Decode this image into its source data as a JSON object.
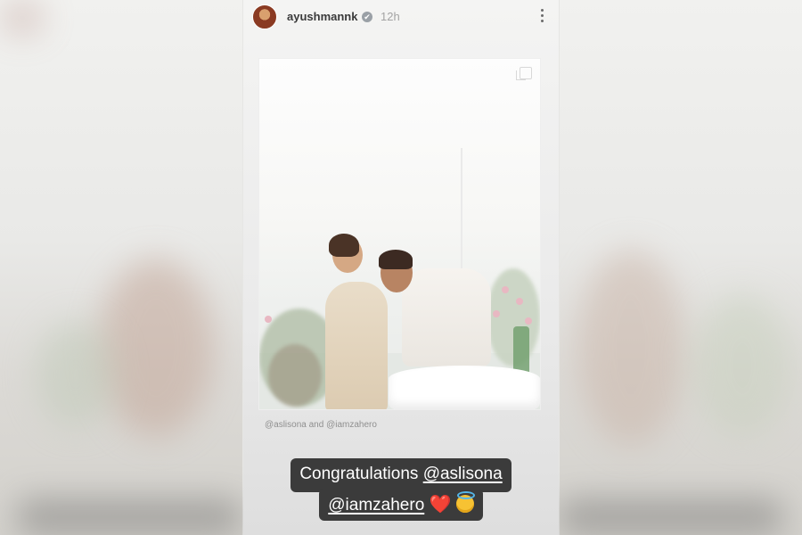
{
  "header": {
    "username": "ayushmannk",
    "verified_icon": "✔",
    "time": "12h",
    "more_icon": "more-vertical-icon"
  },
  "post": {
    "tags": "@aslisona and @iamzahero",
    "icon": "multiple-posts-icon"
  },
  "caption": {
    "line1_text": "Congratulations ",
    "mention1": "@aslisona",
    "mention2": "@iamzahero",
    "heart": "❤️",
    "emoji": "smiling-face-with-halo"
  },
  "colors": {
    "caption_bg": "#3b3b3b",
    "caption_text": "#ffffff",
    "heart": "#e5232a",
    "emoji": "#f7c233"
  }
}
